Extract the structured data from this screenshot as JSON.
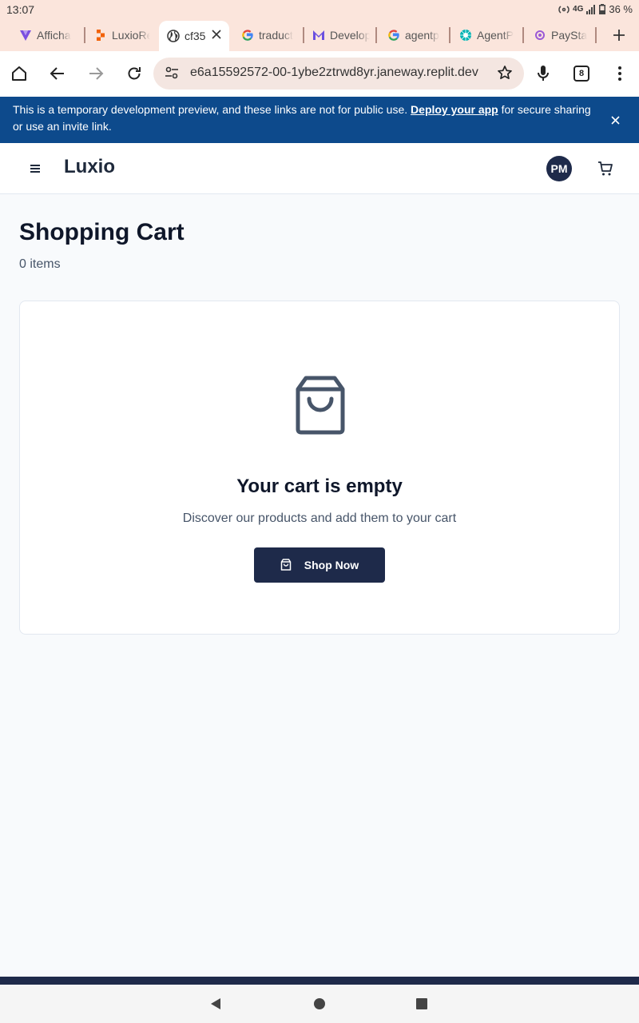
{
  "status_bar": {
    "time": "13:07",
    "network": "4G",
    "battery": "36 %"
  },
  "tabs": [
    {
      "label": "Afficha",
      "favicon": "vuetify-icon",
      "color": "#7b4fe0"
    },
    {
      "label": "LuxioRe",
      "favicon": "replit-icon",
      "color": "#f26207"
    },
    {
      "label": "cf35",
      "favicon": "globe-icon",
      "active": true
    },
    {
      "label": "traduct",
      "favicon": "google-icon"
    },
    {
      "label": "Develop",
      "favicon": "mailchimp-icon",
      "color": "#6b4fe0"
    },
    {
      "label": "agentp",
      "favicon": "google-icon"
    },
    {
      "label": "AgentP",
      "favicon": "agent-icon",
      "color": "#00b3b3"
    },
    {
      "label": "PaySta",
      "favicon": "paystack-icon",
      "color": "#9b59d6"
    }
  ],
  "toolbar": {
    "url": "e6a15592572-00-1ybe2ztrwd8yr.janeway.replit.dev",
    "tab_count": "8"
  },
  "banner": {
    "text_before": "This is a temporary development preview, and these links are not for public use. ",
    "link": "Deploy your app",
    "text_after": " for secure sharing or use an invite link."
  },
  "header": {
    "brand": "Luxio",
    "avatar_initials": "PM"
  },
  "page": {
    "title": "Shopping Cart",
    "item_count": "0 items",
    "empty_title": "Your cart is empty",
    "empty_subtitle": "Discover our products and add them to your cart",
    "shop_button": "Shop Now"
  },
  "colors": {
    "primary": "#1e2a4a",
    "banner": "#0d4a8c",
    "browser_chrome": "#fbe5dc"
  }
}
